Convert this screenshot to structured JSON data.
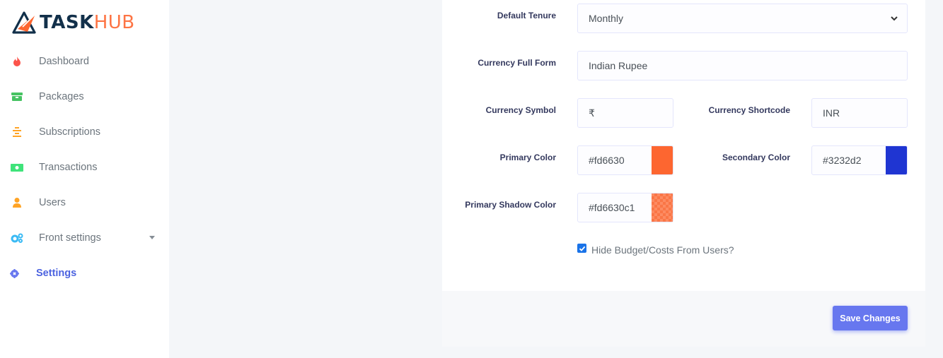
{
  "brand": {
    "name_primary": "TASK",
    "name_secondary": "HUB",
    "colors": {
      "dark": "#12304a",
      "accent": "#fd6630"
    }
  },
  "sidebar": {
    "items": [
      {
        "label": "Dashboard",
        "icon": "fire-icon",
        "color": "#fc544b"
      },
      {
        "label": "Packages",
        "icon": "box-icon",
        "color": "#47c363"
      },
      {
        "label": "Subscriptions",
        "icon": "list-icon",
        "color": "#ffa426"
      },
      {
        "label": "Transactions",
        "icon": "money-icon",
        "color": "#3fe37a"
      },
      {
        "label": "Users",
        "icon": "user-icon",
        "color": "#ffa426"
      },
      {
        "label": "Front settings",
        "icon": "cogs-icon",
        "color": "#3abaf4",
        "has_submenu": true
      },
      {
        "label": "Settings",
        "icon": "gear-icon",
        "color": "#6777ef",
        "active": true
      }
    ]
  },
  "form": {
    "default_tenure": {
      "label": "Default Tenure",
      "value": "Monthly"
    },
    "currency_full_form": {
      "label": "Currency Full Form",
      "value": "Indian Rupee"
    },
    "currency_symbol": {
      "label": "Currency Symbol",
      "value": "₹"
    },
    "currency_shortcode": {
      "label": "Currency Shortcode",
      "value": "INR"
    },
    "primary_color": {
      "label": "Primary Color",
      "value": "#fd6630"
    },
    "secondary_color": {
      "label": "Secondary Color",
      "value": "#3232d2"
    },
    "primary_shadow_color": {
      "label": "Primary Shadow Color",
      "value": "#fd6630c1"
    },
    "hide_budget": {
      "label": "Hide Budget/Costs From Users?",
      "checked": true
    }
  },
  "footer": {
    "save_label": "Save Changes"
  }
}
